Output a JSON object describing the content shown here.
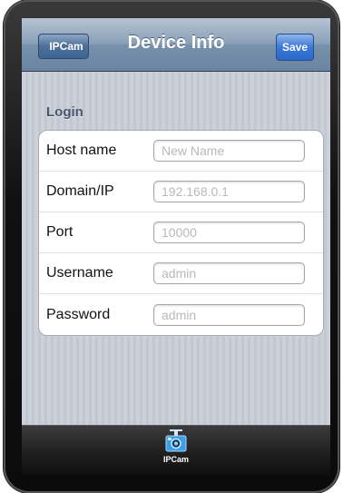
{
  "navbar": {
    "back_label": "IPCam",
    "title": "Device Info",
    "save_label": "Save"
  },
  "section": {
    "title": "Login"
  },
  "rows": [
    {
      "label": "Host name",
      "placeholder": "New Name"
    },
    {
      "label": "Domain/IP",
      "placeholder": "192.168.0.1"
    },
    {
      "label": "Port",
      "placeholder": "10000"
    },
    {
      "label": "Username",
      "placeholder": "admin"
    },
    {
      "label": "Password",
      "placeholder": "admin"
    }
  ],
  "tabbar": {
    "item_label": "IPCam",
    "icon": "ipcam-camera-icon"
  },
  "colors": {
    "navbar": "#7790ab",
    "save_button": "#2c68c7",
    "background": "#c8ccd6"
  }
}
